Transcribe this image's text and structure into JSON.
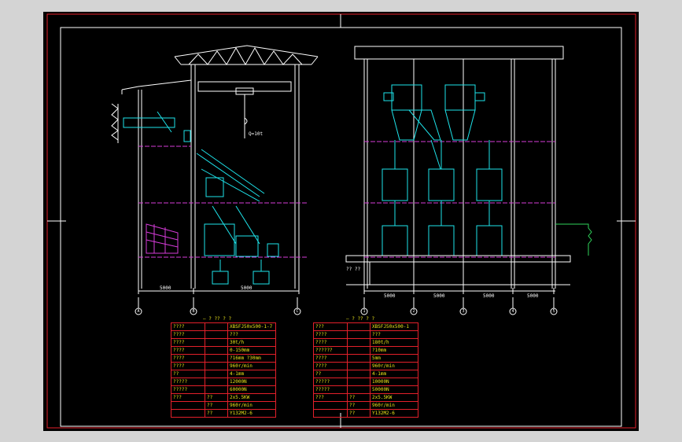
{
  "colors": {
    "background": "#d4d4d4",
    "sheet": "#000000",
    "structure": "#ffffff",
    "equipment": "#1ee3ea",
    "floor_line": "#d63cd9",
    "table_border": "#e3202a",
    "table_text": "#e9e31a",
    "dimension": "#ffffff",
    "guide": "#2fd35a"
  },
  "left_view": {
    "crane_label": "Q=10t",
    "dimensions": [
      "5000",
      "5000"
    ],
    "grid_labels": [
      "A",
      "B",
      "C"
    ],
    "table_title": "— ? ?? ? ?",
    "table_rows": [
      [
        "????",
        "",
        "XBSFJ50x500-1-7"
      ],
      [
        "????",
        "",
        "???"
      ],
      [
        "????",
        "",
        "30t/h"
      ],
      [
        "????",
        "",
        "0-150mm"
      ],
      [
        "????",
        "",
        "?16mm  ?30mm"
      ],
      [
        "????",
        "",
        "960r/min"
      ],
      [
        "??",
        "",
        "4-1mm"
      ],
      [
        "?????",
        "",
        "12000N"
      ],
      [
        "?????",
        "",
        "60000N"
      ]
    ],
    "motor_rows": [
      [
        "???",
        "??",
        "2x5.5KW"
      ],
      [
        "",
        "??",
        "960r/min"
      ],
      [
        "",
        "??",
        "Y132M2-6"
      ]
    ]
  },
  "right_view": {
    "label": "?? ??",
    "dimensions": [
      "5000",
      "5000",
      "5000",
      "5000"
    ],
    "grid_labels": [
      "1",
      "2",
      "3",
      "4",
      "5",
      "6"
    ],
    "table_title": "— ? ?? ? ?",
    "table_rows": [
      [
        "???",
        "",
        "XBSFJ50x500-1"
      ],
      [
        "????",
        "",
        "???"
      ],
      [
        "????",
        "",
        "180t/h"
      ],
      [
        "??????",
        "",
        "?10mm"
      ],
      [
        "????",
        "",
        "5mm"
      ],
      [
        "????",
        "",
        "960r/min"
      ],
      [
        "??",
        "",
        "4-1mm"
      ],
      [
        "?????",
        "",
        "10000N"
      ],
      [
        "?????",
        "",
        "50000N"
      ]
    ],
    "motor_rows": [
      [
        "???",
        "??",
        "2x5.5KW"
      ],
      [
        "",
        "??",
        "960r/min"
      ],
      [
        "",
        "??",
        "Y132M2-6"
      ]
    ]
  }
}
